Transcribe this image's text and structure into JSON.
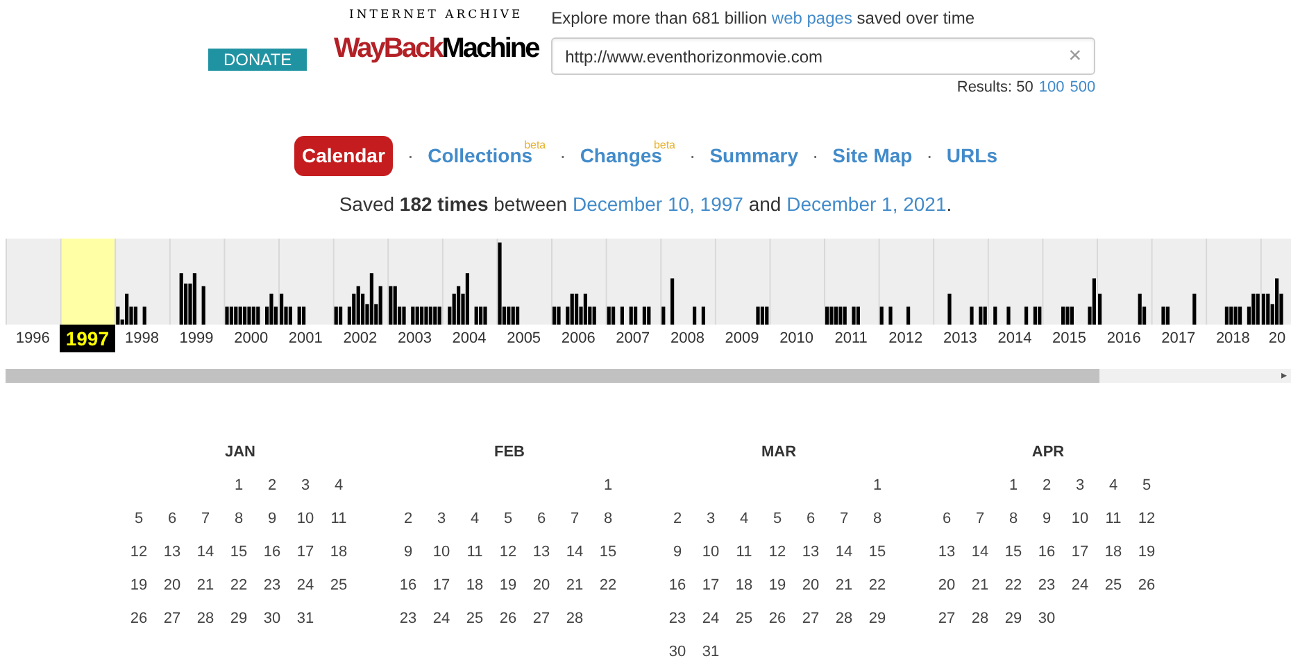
{
  "header": {
    "donate": "DONATE",
    "logo": {
      "top": "INTERNET ARCHIVE",
      "left": "WayBack",
      "right": "Machine"
    },
    "tagline": {
      "before": "Explore more than 681 billion",
      "link": "web pages",
      "after": "saved over time"
    },
    "search": {
      "value": "http://www.eventhorizonmovie.com",
      "clear": "×"
    },
    "results": {
      "label": "Results: 50",
      "links": [
        "100",
        "500"
      ]
    }
  },
  "tabs": [
    {
      "label": "Calendar",
      "selected": true
    },
    {
      "label": "Collections",
      "badge": "beta",
      "selected": false
    },
    {
      "label": "Changes",
      "badge": "beta",
      "selected": false
    },
    {
      "label": "Summary",
      "selected": false
    },
    {
      "label": "Site Map",
      "selected": false
    },
    {
      "label": "URLs",
      "selected": false
    }
  ],
  "tab_separator": "·",
  "summary": {
    "before": "Saved",
    "count": "182 times",
    "middle": "between",
    "first": "December 10, 1997",
    "and": "and",
    "last": "December 1, 2021",
    "end": "."
  },
  "years": [
    {
      "label": "1996",
      "selected": false
    },
    {
      "label": "1997",
      "selected": true
    },
    {
      "label": "1998",
      "selected": false
    },
    {
      "label": "1999",
      "selected": false
    },
    {
      "label": "2000",
      "selected": false
    },
    {
      "label": "2001",
      "selected": false
    },
    {
      "label": "2002",
      "selected": false
    },
    {
      "label": "2003",
      "selected": false
    },
    {
      "label": "2004",
      "selected": false
    },
    {
      "label": "2005",
      "selected": false
    },
    {
      "label": "2006",
      "selected": false
    },
    {
      "label": "2007",
      "selected": false
    },
    {
      "label": "2008",
      "selected": false
    },
    {
      "label": "2009",
      "selected": false
    },
    {
      "label": "2010",
      "selected": false
    },
    {
      "label": "2011",
      "selected": false
    },
    {
      "label": "2012",
      "selected": false
    },
    {
      "label": "2013",
      "selected": false
    },
    {
      "label": "2014",
      "selected": false
    },
    {
      "label": "2015",
      "selected": false
    },
    {
      "label": "2016",
      "selected": false
    },
    {
      "label": "2017",
      "selected": false
    },
    {
      "label": "2018",
      "selected": false
    },
    {
      "label": "20",
      "selected": false
    }
  ],
  "scroll_arrow": "▸",
  "months": [
    {
      "name": "JAN",
      "weeks": [
        [
          "1",
          "2",
          "3",
          "4"
        ],
        [
          "5",
          "6",
          "7",
          "8",
          "9",
          "10",
          "11"
        ],
        [
          "12",
          "13",
          "14",
          "15",
          "16",
          "17",
          "18"
        ],
        [
          "19",
          "20",
          "21",
          "22",
          "23",
          "24",
          "25"
        ],
        [
          "26",
          "27",
          "28",
          "29",
          "30",
          "31"
        ]
      ]
    },
    {
      "name": "FEB",
      "weeks": [
        [
          "1"
        ],
        [
          "2",
          "3",
          "4",
          "5",
          "6",
          "7",
          "8"
        ],
        [
          "9",
          "10",
          "11",
          "12",
          "13",
          "14",
          "15"
        ],
        [
          "16",
          "17",
          "18",
          "19",
          "20",
          "21",
          "22"
        ],
        [
          "23",
          "24",
          "25",
          "26",
          "27",
          "28"
        ]
      ]
    },
    {
      "name": "MAR",
      "weeks": [
        [
          "1"
        ],
        [
          "2",
          "3",
          "4",
          "5",
          "6",
          "7",
          "8"
        ],
        [
          "9",
          "10",
          "11",
          "12",
          "13",
          "14",
          "15"
        ],
        [
          "16",
          "17",
          "18",
          "19",
          "20",
          "21",
          "22"
        ],
        [
          "23",
          "24",
          "25",
          "26",
          "27",
          "28",
          "29"
        ],
        [
          "30",
          "31"
        ]
      ]
    },
    {
      "name": "APR",
      "weeks": [
        [
          "1",
          "2",
          "3",
          "4",
          "5"
        ],
        [
          "6",
          "7",
          "8",
          "9",
          "10",
          "11",
          "12"
        ],
        [
          "13",
          "14",
          "15",
          "16",
          "17",
          "18",
          "19"
        ],
        [
          "20",
          "21",
          "22",
          "23",
          "24",
          "25",
          "26"
        ],
        [
          "27",
          "28",
          "29",
          "30"
        ]
      ]
    }
  ]
}
